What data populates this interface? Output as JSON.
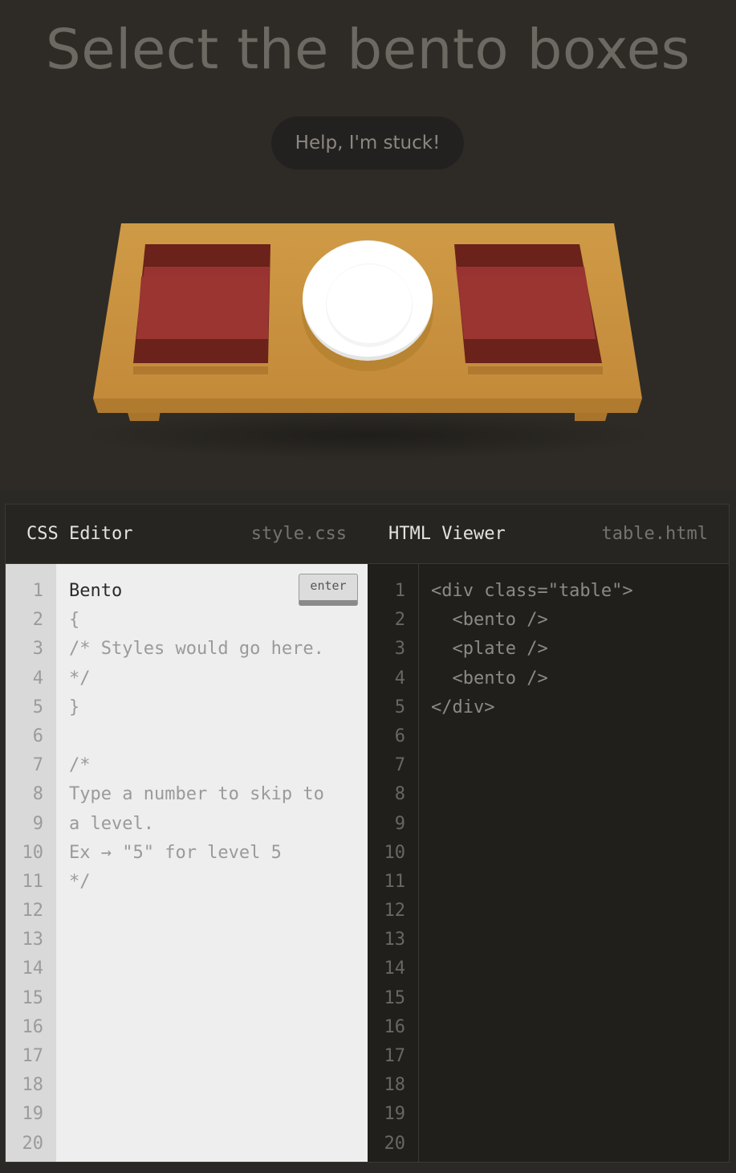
{
  "game": {
    "order": "Select the bento boxes",
    "help_label": "Help, I'm stuck!"
  },
  "css_editor": {
    "title": "CSS Editor",
    "filename": "style.css",
    "enter_label": "enter",
    "line_numbers": [
      "1",
      "2",
      "3",
      "4",
      "5",
      "6",
      "7",
      "8",
      "9",
      "10",
      "11",
      "12",
      "13",
      "14",
      "15",
      "16",
      "17",
      "18",
      "19",
      "20"
    ],
    "input_value": "Bento",
    "code_lines": [
      "{",
      "/* Styles would go here.",
      "*/",
      "}",
      "",
      "/*",
      "Type a number to skip to",
      "a level.",
      "Ex → \"5\" for level 5",
      "*/"
    ]
  },
  "html_viewer": {
    "title": "HTML Viewer",
    "filename": "table.html",
    "line_numbers": [
      "1",
      "2",
      "3",
      "4",
      "5",
      "6",
      "7",
      "8",
      "9",
      "10",
      "11",
      "12",
      "13",
      "14",
      "15",
      "16",
      "17",
      "18",
      "19",
      "20"
    ],
    "code_lines": [
      "<div class=\"table\">",
      "  <bento />",
      "  <plate />",
      "  <bento />",
      "</div>"
    ]
  },
  "colors": {
    "table_top": "#c8933e",
    "bento_dark": "#6a221a",
    "bento_light": "#993332",
    "plate": "#ffffff"
  }
}
